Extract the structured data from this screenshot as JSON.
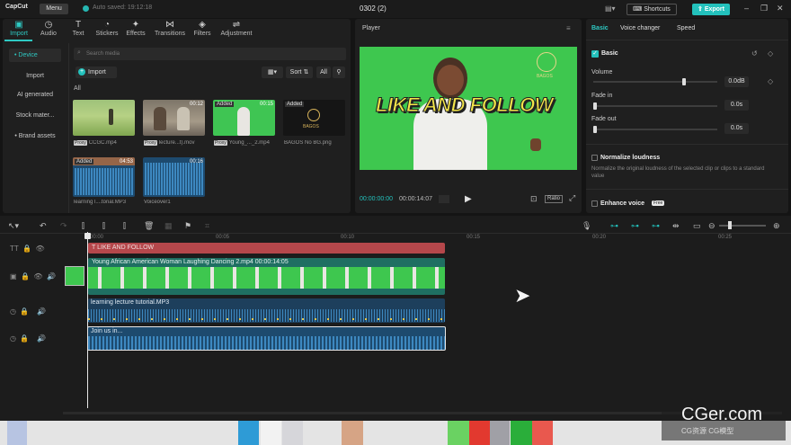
{
  "titlebar": {
    "logo": "CapCut",
    "menu": "Menu",
    "save_status": "Auto saved: 19:12:18",
    "project": "0302 (2)",
    "shortcuts": "Shortcuts",
    "export": "Export"
  },
  "toolbar": {
    "tabs": [
      "Import",
      "Audio",
      "Text",
      "Stickers",
      "Effects",
      "Transitions",
      "Filters",
      "Adjustment"
    ]
  },
  "sidebar": {
    "items": [
      "• Device",
      "Import",
      "AI generated",
      "Stock mater...",
      "• Brand assets"
    ]
  },
  "media": {
    "search_placeholder": "Search media",
    "import_label": "Import",
    "sort_label": "Sort",
    "all_chip": "All",
    "all_heading": "All",
    "items": [
      {
        "name": "CCGC.mp4",
        "badge": "",
        "dur": "",
        "proxy": "Proxy"
      },
      {
        "name": "lecture...t).mov",
        "badge": "",
        "dur": "00:12",
        "proxy": "Proxy"
      },
      {
        "name": "Young_..._2.mp4",
        "badge": "Added",
        "dur": "00:15",
        "proxy": "Proxy"
      },
      {
        "name": "BAGOS No BG.png",
        "badge": "Added",
        "dur": "",
        "proxy": ""
      },
      {
        "name": "learning l....torial.MP3",
        "badge": "Added",
        "dur": "04:53",
        "proxy": ""
      },
      {
        "name": "Voiceover1",
        "badge": "",
        "dur": "00:16",
        "proxy": ""
      }
    ]
  },
  "player": {
    "title": "Player",
    "overlay_text": "LIKE AND FOLLOW",
    "current": "00:00:00:00",
    "total": "00:00:14:07",
    "ratio": "Ratio",
    "brand": "BAGOS"
  },
  "inspector": {
    "tabs": [
      "Basic",
      "Voice changer",
      "Speed"
    ],
    "section": "Basic",
    "volume_label": "Volume",
    "volume_value": "0.0dB",
    "fadein_label": "Fade in",
    "fadein_value": "0.0s",
    "fadeout_label": "Fade out",
    "fadeout_value": "0.0s",
    "normalize_label": "Normalize loudness",
    "normalize_desc": "Normalize the original loudness of the selected clip or clips to a standard value",
    "enhance_label": "Enhance voice",
    "enhance_badge": "Free"
  },
  "timeline": {
    "ticks": [
      "00:00",
      "00:05",
      "00:10",
      "00:15",
      "00:20",
      "00:25"
    ],
    "text_clip": "LIKE AND FOLLOW",
    "video_clip": "Young African American Woman Laughing Dancing 2.mp4  00:00:14:05",
    "audio_clip": "learning lecture tutorial.MP3",
    "voice_clip": "Join us in..."
  },
  "watermark": {
    "main": "CGer.com",
    "sub": "CG资源 CG模型"
  },
  "colors": {
    "accent": "#23c1bc",
    "text_clip": "#b5474b",
    "video_clip": "#1f6f62",
    "audio_clip": "#1d3f5c"
  }
}
